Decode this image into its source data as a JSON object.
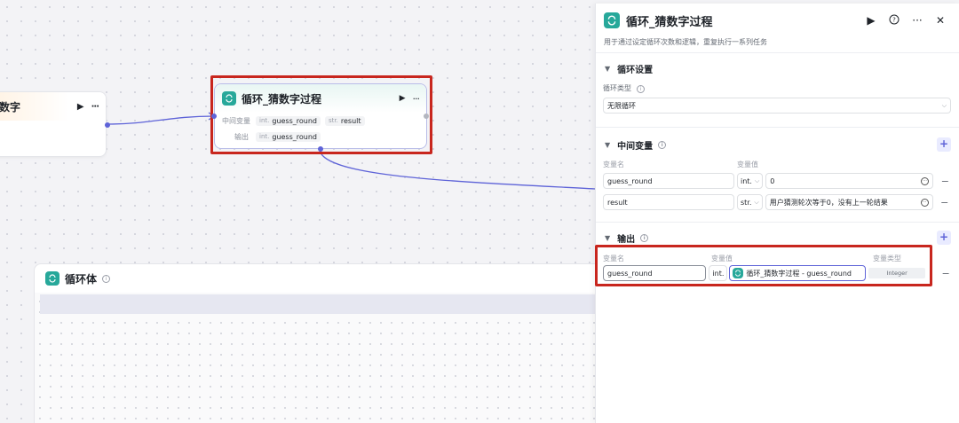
{
  "canvas": {
    "left_node": {
      "title": "数字",
      "run_icon": "play-icon",
      "more_icon": "more-icon"
    },
    "loop_node": {
      "title": "循环_猜数字过程",
      "rows": [
        {
          "label": "中间变量",
          "chips": [
            {
              "type": "int.",
              "name": "guess_round"
            },
            {
              "type": "str.",
              "name": "result"
            }
          ]
        },
        {
          "label": "输出",
          "chips": [
            {
              "type": "int.",
              "name": "guess_round"
            }
          ]
        }
      ]
    },
    "loop_body": {
      "title": "循环体"
    }
  },
  "panel": {
    "title": "循环_猜数字过程",
    "description": "用于通过设定循环次数和逻辑，重复执行一系列任务",
    "actions": {
      "run": "play-icon",
      "help": "question-circle-icon",
      "more": "more-icon",
      "close": "close-icon"
    },
    "loop_settings": {
      "heading": "循环设置",
      "type_label": "循环类型",
      "type_value": "无限循环"
    },
    "intermediate": {
      "heading": "中间变量",
      "col_name": "变量名",
      "col_value": "变量值",
      "rows": [
        {
          "name": "guess_round",
          "type": "int.",
          "value": "0"
        },
        {
          "name": "result",
          "type": "str.",
          "value": "用户猜测轮次等于0，没有上一轮结果"
        }
      ]
    },
    "output": {
      "heading": "输出",
      "col_name": "变量名",
      "col_value": "变量值",
      "col_type": "变量类型",
      "rows": [
        {
          "name": "guess_round",
          "type": "int.",
          "ref": "循环_猜数字过程 - guess_round",
          "var_type": "Integer"
        }
      ]
    }
  },
  "colors": {
    "accent": "#5e63d8",
    "loop_icon": "#27a89a",
    "highlight": "#c8261e"
  }
}
